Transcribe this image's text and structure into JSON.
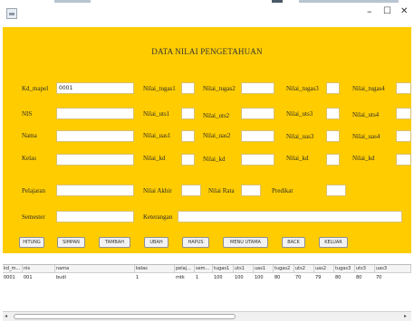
{
  "window": {
    "minimize_glyph": "–",
    "maximize_glyph": "☐",
    "close_glyph": "✕"
  },
  "form": {
    "title": "DATA NILAI PENGETAHUAN",
    "fields": {
      "kd_mapel": {
        "label": "Kd_mapel",
        "value": "0001"
      },
      "nis": {
        "label": "NIS",
        "value": ""
      },
      "nama": {
        "label": "Nama",
        "value": ""
      },
      "kelas": {
        "label": "Kelas",
        "value": ""
      },
      "pelajaran": {
        "label": "Pelajaran",
        "value": ""
      },
      "semester": {
        "label": "Semester",
        "value": ""
      },
      "nilai_tugas1": {
        "label": "Nilai_tugas1",
        "value": ""
      },
      "nilai_uts1": {
        "label": "Nilai_uts1",
        "value": ""
      },
      "nilai_uas1": {
        "label": "Nilai_uas1",
        "value": ""
      },
      "nilai_kd_1": {
        "label": "Nilai_kd",
        "value": ""
      },
      "nilai_tugas2": {
        "label": "Nilai_tugas2",
        "value": ""
      },
      "nilai_uts2": {
        "label": "Nilai_uts2",
        "value": ""
      },
      "nilai_uas2": {
        "label": "Nilai_uas2",
        "value": ""
      },
      "nilai_kd_2": {
        "label": "Nilai_kd",
        "value": ""
      },
      "nilai_tugas3": {
        "label": "Nilai_tugas3",
        "value": ""
      },
      "nilai_uts3": {
        "label": "Nilai_uts3",
        "value": ""
      },
      "nilai_uas3": {
        "label": "Nilai_uas3",
        "value": ""
      },
      "nilai_kd_3": {
        "label": "Nilai_kd",
        "value": ""
      },
      "nilai_tugas4": {
        "label": "Nilai_tugas4",
        "value": ""
      },
      "nilai_uts4": {
        "label": "Nilai_uts4",
        "value": ""
      },
      "nilai_uas4": {
        "label": "Nilai_uas4",
        "value": ""
      },
      "nilai_kd_4": {
        "label": "Nilai_kd",
        "value": ""
      },
      "nilai_akhir": {
        "label": "Nilai Akhir",
        "value": ""
      },
      "nilai_rata": {
        "label": "Nilai Rata",
        "value": ""
      },
      "predikat": {
        "label": "Predikat",
        "value": ""
      },
      "keterangan": {
        "label": "Keterangan",
        "value": ""
      }
    }
  },
  "buttons": {
    "hitung": "HITUNG",
    "simpan": "SIMPAN",
    "tambah": "TAMBAH",
    "ubah": "UBAH",
    "hapus": "HAPUS",
    "menu_utama": "MENU UTAMA",
    "back": "BACK",
    "keluar": "KELUAR"
  },
  "table": {
    "columns": [
      "kd_m...",
      "nis",
      "nama",
      "kelas",
      "pelaj...",
      "sem...",
      "tugas1",
      "uts1",
      "uas1",
      "tugas2",
      "uts2",
      "uas2",
      "tugas3",
      "uts3",
      "uas3"
    ],
    "rows": [
      [
        "0001",
        "001",
        "budi",
        "1",
        "mtk",
        "1",
        "100",
        "100",
        "100",
        "80",
        "70",
        "79",
        "80",
        "80",
        "70"
      ]
    ]
  },
  "scrollbar": {
    "left_glyph": "◂",
    "right_glyph": "▸"
  }
}
